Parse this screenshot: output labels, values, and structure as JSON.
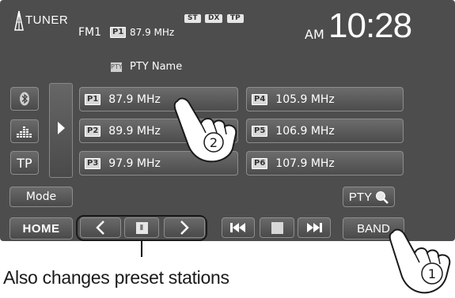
{
  "header": {
    "source_label": "TUNER",
    "band": "FM1",
    "current_preset_badge": "P1",
    "current_frequency": "87.9 MHz",
    "indicators": [
      "ST",
      "DX",
      "TP"
    ],
    "am_pm": "AM",
    "clock": "10:28"
  },
  "pty": {
    "badge": "PTY",
    "name": "PTY Name"
  },
  "side_buttons": {
    "bluetooth_icon": "bluetooth-icon",
    "equalizer_icon": "equalizer-icon",
    "tp_label": "TP"
  },
  "presets": [
    {
      "badge": "P1",
      "frequency": "87.9 MHz"
    },
    {
      "badge": "P2",
      "frequency": "89.9 MHz"
    },
    {
      "badge": "P3",
      "frequency": "97.9 MHz"
    },
    {
      "badge": "P4",
      "frequency": "105.9 MHz"
    },
    {
      "badge": "P5",
      "frequency": "106.9 MHz"
    },
    {
      "badge": "P6",
      "frequency": "107.9 MHz"
    }
  ],
  "controls": {
    "mode_label": "Mode",
    "pty_search_label": "PTY",
    "home_label": "HOME",
    "band_label": "BAND"
  },
  "callouts": {
    "step_1": "1",
    "step_2": "2",
    "caption": "Also changes preset stations"
  },
  "colors": {
    "screen_bg": "#4d4d4d",
    "button_border": "#8d8d8d",
    "text": "#ffffff"
  }
}
